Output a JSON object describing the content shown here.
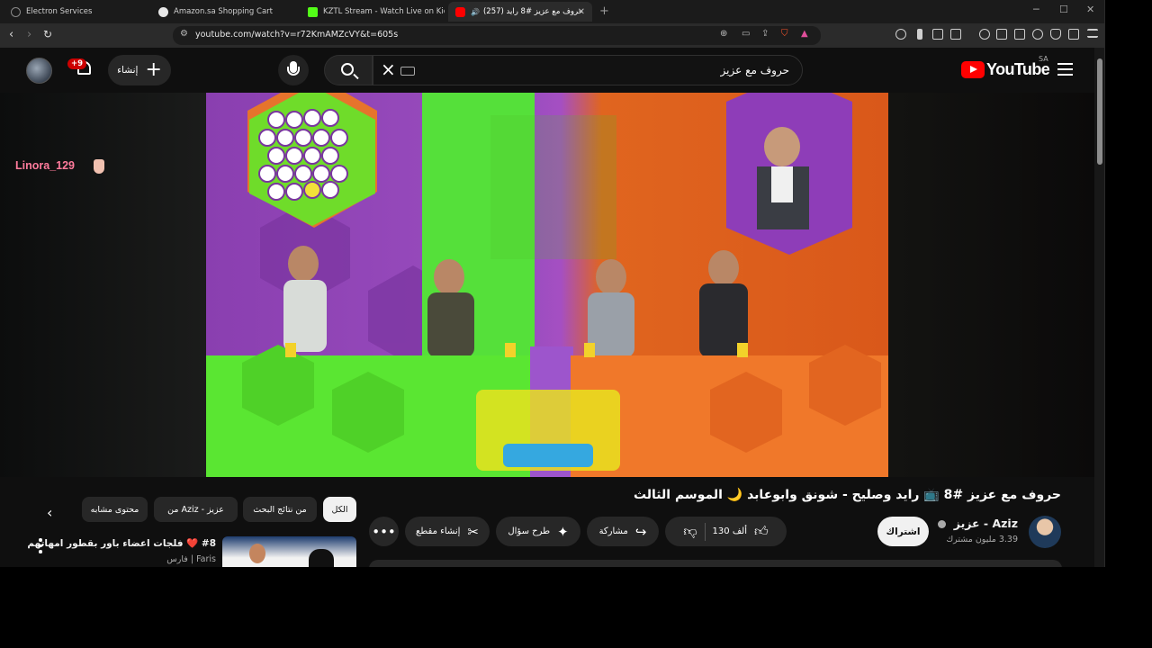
{
  "tabs": [
    {
      "title": "Electron Services",
      "color": "#7a7a7a"
    },
    {
      "title": "Amazon.sa Shopping Cart",
      "color": "#e8e8e8"
    },
    {
      "title": "KZTL Stream - Watch Live on Kick",
      "color": "#53fc18"
    },
    {
      "title": "(257) حروف مع عزيز #8 رايد",
      "color": "#ff0000"
    }
  ],
  "address": {
    "url": "youtube.com/watch?v=r72KmAMZcVY&t=605s"
  },
  "header": {
    "logo_text": "YouTube",
    "country": "SA",
    "search_query": "حروف مع عزيز",
    "create_label": "إنشاء",
    "notification_badge": "+9"
  },
  "video": {
    "overlay_username": "Linora_129",
    "title": "حروف مع عزيز #8 📺 رايد وصليح - شونق وابوعابد 🌙 الموسم الثالث"
  },
  "channel": {
    "name": "Aziz - عزيز",
    "subscribers": "3.39 مليون مشترك",
    "subscribe_label": "اشتراك"
  },
  "actions": {
    "likes": "130 ألف",
    "share": "مشاركة",
    "ask": "طرح سؤال",
    "clip": "إنشاء مقطع"
  },
  "chips": [
    "الكل",
    "من نتائج البحث",
    "من Aziz - عزيز",
    "محتوى مشابه"
  ],
  "recommended": {
    "title": "#8 ❤️ فلجات اعضاء باور بقطور امهاتهم",
    "channel": "Faris | فارس"
  }
}
